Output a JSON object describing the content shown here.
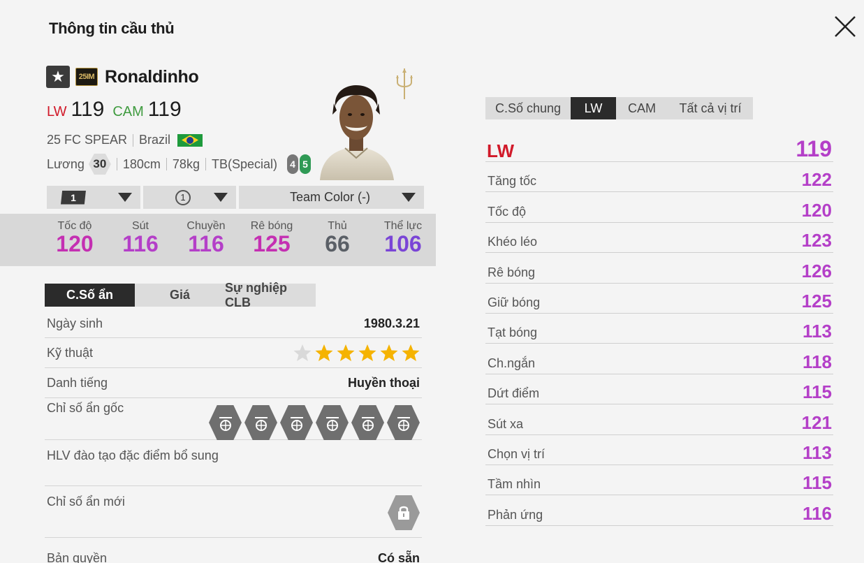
{
  "title": "Thông tin cầu thủ",
  "player": {
    "name": "Ronaldinho",
    "season_badge": "25IM",
    "positions": [
      {
        "pos": "LW",
        "ovr": "119"
      },
      {
        "pos": "CAM",
        "ovr": "119"
      }
    ],
    "club": "25 FC SPEAR",
    "nation": "Brazil",
    "salary_label": "Lương",
    "salary": "30",
    "height": "180cm",
    "weight": "78kg",
    "body": "TB(Special)",
    "weak_foot": "4",
    "strong_foot": "5"
  },
  "dropdowns": {
    "level": "1",
    "training": "1",
    "team_color": "Team Color (-)"
  },
  "main_stats": [
    {
      "label": "Tốc độ",
      "value": "120",
      "color": "#c42fb2"
    },
    {
      "label": "Sút",
      "value": "116",
      "color": "#b43fc8"
    },
    {
      "label": "Chuyền",
      "value": "116",
      "color": "#b43fc8"
    },
    {
      "label": "Rê bóng",
      "value": "125",
      "color": "#c42fb2"
    },
    {
      "label": "Thủ",
      "value": "66",
      "color": "#5a5f66"
    },
    {
      "label": "Thể lực",
      "value": "106",
      "color": "#7a45d6"
    }
  ],
  "left_tabs": [
    "C.Số ẩn",
    "Giá",
    "Sự nghiệp CLB"
  ],
  "hidden": {
    "birth_label": "Ngày sinh",
    "birth": "1980.3.21",
    "skill_label": "Kỹ thuật",
    "skill_stars": 5,
    "skill_max": 6,
    "rep_label": "Danh tiếng",
    "rep": "Huyền thoại",
    "traits_label": "Chỉ số ẩn gốc",
    "traits": [
      "trait-power-header-icon",
      "trait-flair-icon",
      "trait-technical-dribbler-icon",
      "trait-speed-dribbler-icon",
      "trait-playmaker-icon",
      "trait-skill-icon"
    ],
    "coach_label": "HLV đào tạo đặc điểm bổ sung",
    "new_label": "Chỉ số ẩn mới",
    "license_label": "Bản quyền",
    "license": "Có sẵn"
  },
  "right_tabs": [
    "C.Số chung",
    "LW",
    "CAM",
    "Tất cả vị trí"
  ],
  "detail": {
    "position": "LW",
    "ovr": "119",
    "rows": [
      {
        "label": "Tăng tốc",
        "value": "122"
      },
      {
        "label": "Tốc độ",
        "value": "120"
      },
      {
        "label": "Khéo léo",
        "value": "123"
      },
      {
        "label": "Rê bóng",
        "value": "126"
      },
      {
        "label": "Giữ bóng",
        "value": "125"
      },
      {
        "label": "Tạt bóng",
        "value": "113"
      },
      {
        "label": "Ch.ngắn",
        "value": "118"
      },
      {
        "label": "Dứt điểm",
        "value": "115"
      },
      {
        "label": "Sút xa",
        "value": "121"
      },
      {
        "label": "Chọn vị trí",
        "value": "113"
      },
      {
        "label": "Tầm nhìn",
        "value": "115"
      },
      {
        "label": "Phản ứng",
        "value": "116"
      }
    ]
  }
}
